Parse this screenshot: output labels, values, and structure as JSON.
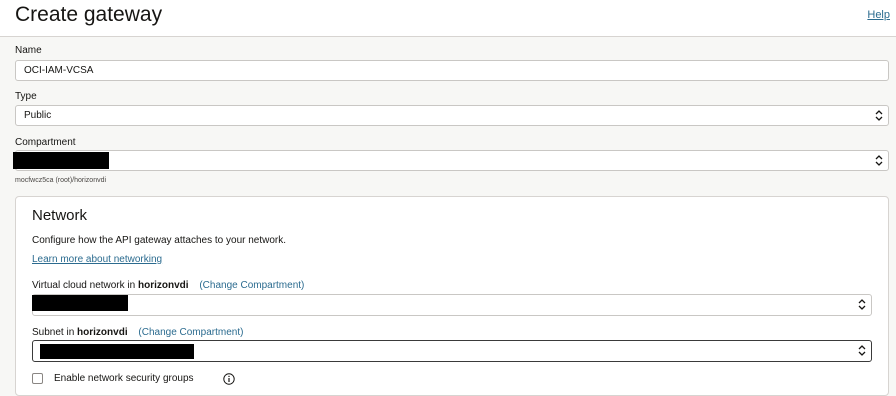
{
  "header": {
    "title": "Create gateway",
    "help_label": "Help"
  },
  "form": {
    "name": {
      "label": "Name",
      "value": "OCI-IAM-VCSA"
    },
    "type": {
      "label": "Type",
      "value": "Public"
    },
    "compartment": {
      "label": "Compartment",
      "path_hint": "mocfwcz5ca (root)/horizonvdi"
    }
  },
  "network": {
    "title": "Network",
    "description": "Configure how the API gateway attaches to your network.",
    "learn_more": "Learn more about networking",
    "vcn": {
      "label_prefix": "Virtual cloud network in",
      "compartment": "horizonvdi",
      "change_link": "(Change Compartment)"
    },
    "subnet": {
      "label_prefix": "Subnet in",
      "compartment": "horizonvdi",
      "change_link": "(Change Compartment)"
    },
    "nsg_checkbox": {
      "label": "Enable network security groups",
      "checked": false
    }
  },
  "icons": {
    "select_arrow": "chevron-up-down-icon",
    "info": "info-icon"
  }
}
